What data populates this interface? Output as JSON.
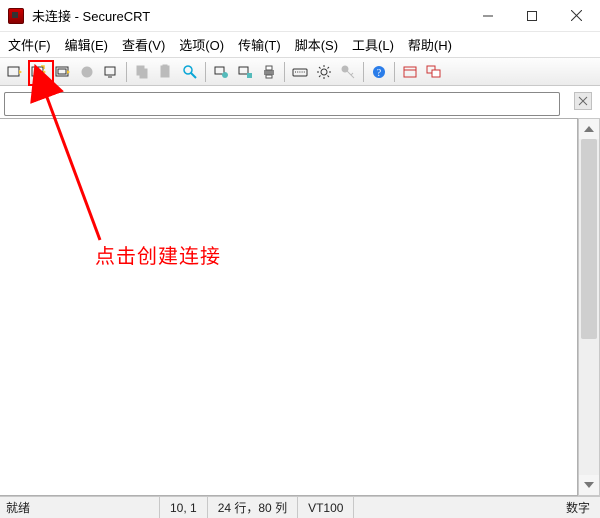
{
  "title": "未连接 - SecureCRT",
  "menu": {
    "items": [
      "文件(F)",
      "编辑(E)",
      "查看(V)",
      "选项(O)",
      "传输(T)",
      "脚本(S)",
      "工具(L)",
      "帮助(H)"
    ]
  },
  "toolbar": {
    "icons": [
      "quick-connect-icon",
      "new-session-icon",
      "session-manager-icon",
      "reconnect-icon",
      "disconnect-icon",
      "sep",
      "copy-icon",
      "paste-icon",
      "find-icon",
      "sep",
      "host-a-icon",
      "host-b-icon",
      "print-icon",
      "sep",
      "keymap-icon",
      "settings-icon",
      "key-icon",
      "sep",
      "help-icon",
      "sep",
      "window-a-icon",
      "window-b-icon"
    ]
  },
  "annotation": {
    "text": "点击创建连接"
  },
  "status": {
    "ready": "就绪",
    "cursor": "10, 1",
    "size": "24 行，80 列",
    "term": "VT100",
    "right": "数字"
  }
}
